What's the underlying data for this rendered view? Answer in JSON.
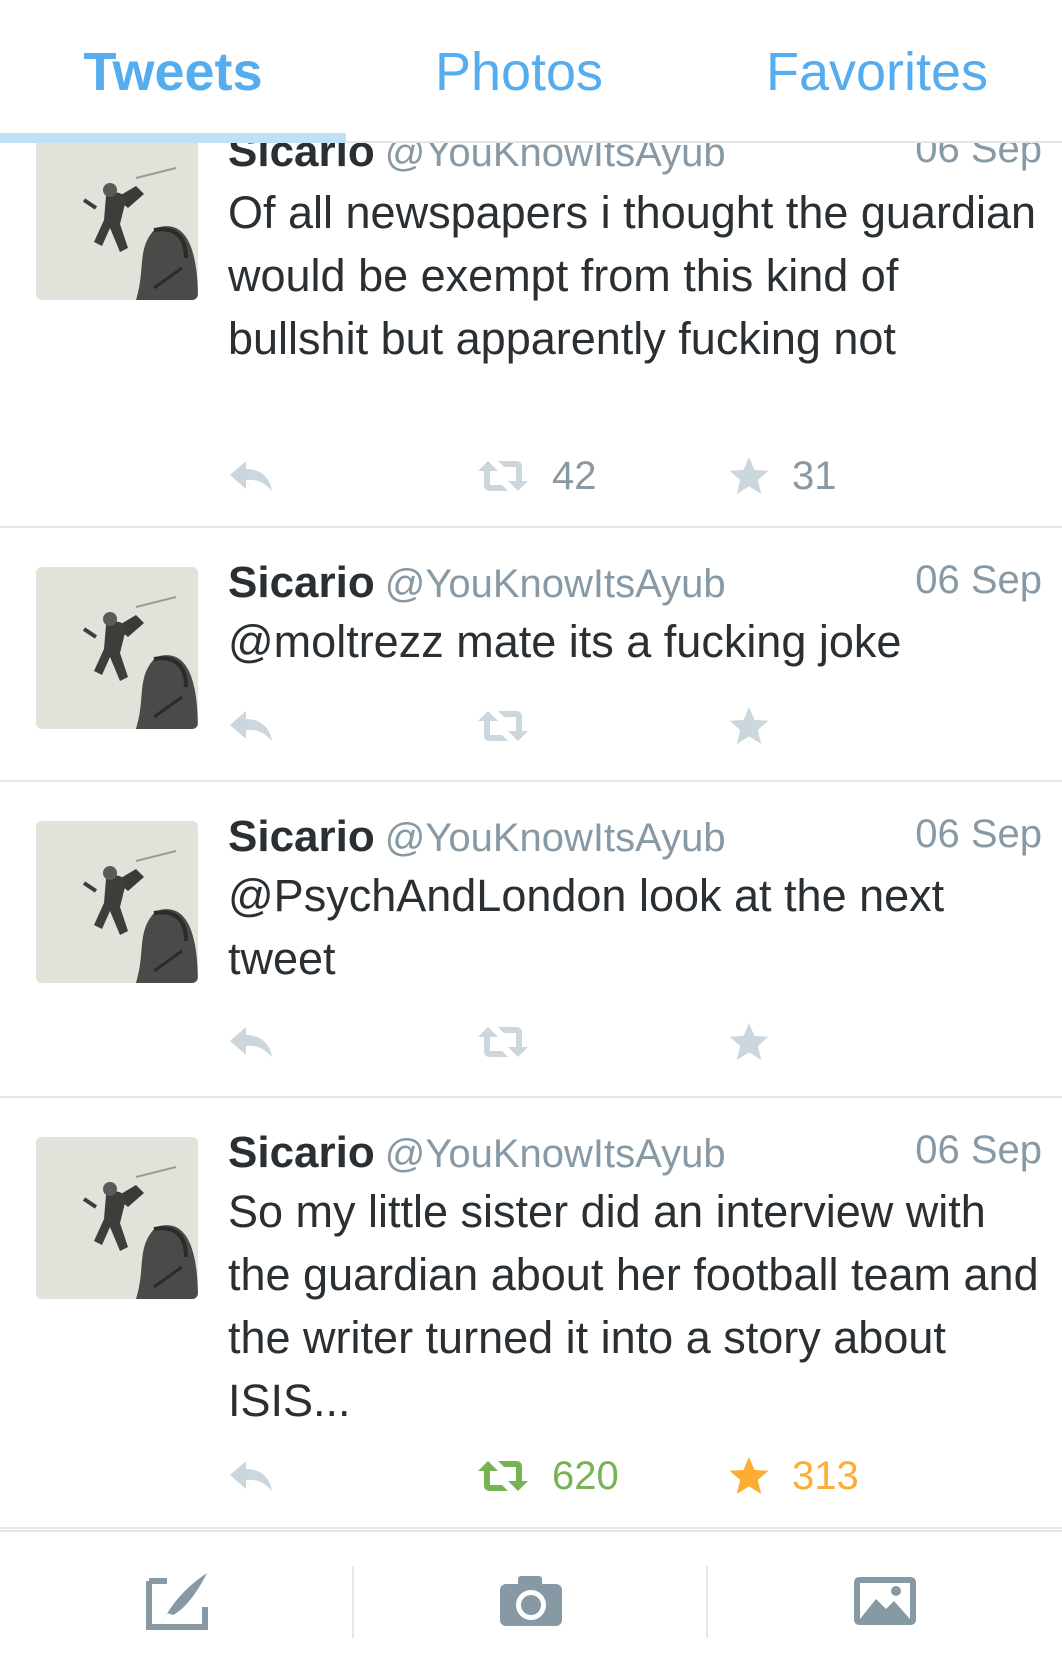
{
  "tabs": [
    {
      "label": "Tweets"
    },
    {
      "label": "Photos"
    },
    {
      "label": "Favorites"
    }
  ],
  "tweets": [
    {
      "name": "Sicario",
      "handle": "@YouKnowItsAyub",
      "date": "06 Sep",
      "text": "Of all newspapers i thought the guardian would be exempt from this kind of bullshit but apparently fucking not",
      "retweets": "42",
      "favorites": "31",
      "retweeted": false,
      "favorited": false
    },
    {
      "name": "Sicario",
      "handle": "@YouKnowItsAyub",
      "date": "06 Sep",
      "text": "@moltrezz mate its a fucking joke",
      "retweets": "",
      "favorites": "",
      "retweeted": false,
      "favorited": false
    },
    {
      "name": "Sicario",
      "handle": "@YouKnowItsAyub",
      "date": "06 Sep",
      "text": "@PsychAndLondon look at the next tweet",
      "retweets": "",
      "favorites": "",
      "retweeted": false,
      "favorited": false
    },
    {
      "name": "Sicario",
      "handle": "@YouKnowItsAyub",
      "date": "06 Sep",
      "text": "So my little sister did an interview with the guardian about her football team and the writer turned it into a story about ISIS...",
      "retweets": "620",
      "favorites": "313",
      "retweeted": true,
      "favorited": true
    }
  ],
  "toolbar": [
    {
      "icon": "compose-icon"
    },
    {
      "icon": "camera-icon"
    },
    {
      "icon": "image-icon"
    }
  ],
  "colors": {
    "accent": "#55acee",
    "muted": "#8899a6",
    "retweet_active": "#77b255",
    "favorite_active": "#ffac33",
    "icon_inactive": "#ccd6dd"
  }
}
